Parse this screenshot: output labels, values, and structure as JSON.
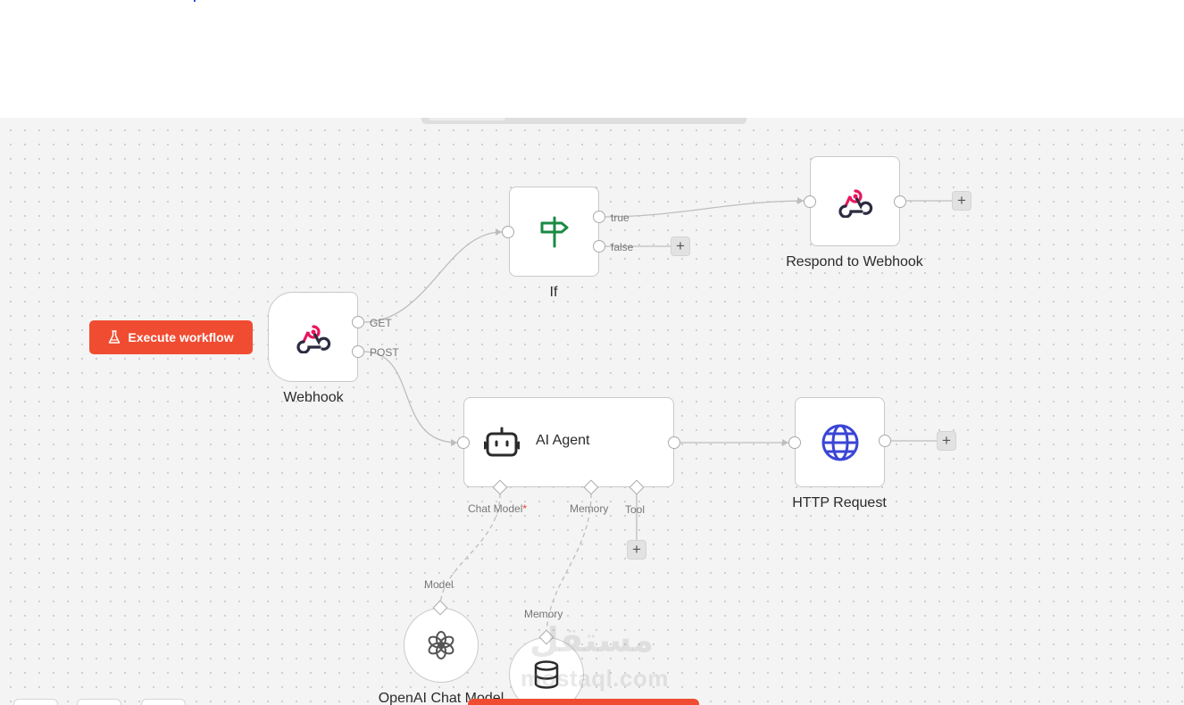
{
  "canvas": {
    "execute_button": {
      "label": "Execute workflow",
      "icon": "flask-icon"
    }
  },
  "nodes": {
    "webhook": {
      "label": "Webhook",
      "icon": "webhook-icon",
      "outputs": [
        "GET",
        "POST"
      ]
    },
    "if": {
      "label": "If",
      "icon": "signpost-icon",
      "outputs": [
        "true",
        "false"
      ]
    },
    "respond": {
      "label": "Respond to Webhook",
      "icon": "webhook-icon"
    },
    "ai_agent": {
      "label": "AI Agent",
      "icon": "robot-icon",
      "inputs": {
        "chat_model": "Chat Model",
        "required_mark": "*",
        "memory": "Memory",
        "tool": "Tool"
      }
    },
    "http": {
      "label": "HTTP Request",
      "icon": "globe-icon"
    },
    "openai": {
      "label": "OpenAI Chat Model",
      "icon": "openai-icon",
      "port_label": "Model"
    },
    "memory": {
      "icon": "database-icon",
      "port_label": "Memory"
    }
  },
  "add_button_symbol": "+",
  "watermark": {
    "arabic": "مستقل",
    "latin": "mostaql.com"
  },
  "colors": {
    "accent": "#f04c31",
    "webhook_pink": "#e8175d",
    "if_green": "#1a8a44",
    "globe_blue": "#3a45d6"
  }
}
